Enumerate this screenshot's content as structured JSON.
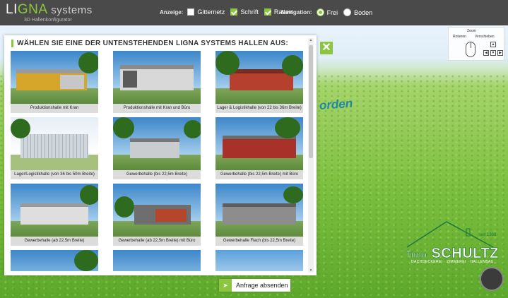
{
  "app": {
    "logo_main_a": "LI",
    "logo_main_b": "GNA",
    "logo_main_c": " systems",
    "logo_sub": "3D Hallenkonfigurator"
  },
  "toolbar": {
    "display_label": "Anzeige:",
    "display_options": [
      {
        "label": "Gitternetz",
        "checked": false
      },
      {
        "label": "Schrift",
        "checked": true
      },
      {
        "label": "Rasen",
        "checked": true
      }
    ],
    "nav_label": "Navigation:",
    "nav_options": [
      {
        "label": "Frei",
        "selected": true
      },
      {
        "label": "Boden",
        "selected": false
      }
    ]
  },
  "panel": {
    "title": "WÄHLEN SIE EINE DER UNTENSTEHENDEN LIGNA SYSTEMS HALLEN AUS:",
    "tiles": [
      "Produktionshalle mit Kran",
      "Produktionshalle mit Kran und Büro",
      "Lager & Logistikhalle (von 22 bis 36m Breite)",
      "Lager/Logistikhalle (von 36 bis 50m Breite)",
      "Gewerbehalle (bis 22,5m Breite)",
      "Gewerbehalle (bis 22,5m Breite) mit Büro",
      "Gewerbehalle (ab 22,5m Breite)",
      "Gewerbehalle (ab 22,5m Breite) mit Büro",
      "Gewerbehalle Flach (bis 22,5m Breite)",
      "",
      "",
      ""
    ]
  },
  "scene": {
    "label": "orden"
  },
  "navhelp": {
    "zoom": "Zoom",
    "rotate": "Rotieren",
    "move": "Verschieben"
  },
  "brand": {
    "name_small": "Timo",
    "name_big": "SCHULTZ",
    "since": "seit 1998",
    "tagline": "DACHDECKEREI · ZIMMEREI · HALLENBAU"
  },
  "submit": {
    "label": "Anfrage absenden"
  },
  "colors": {
    "accent": "#8cc63f",
    "topbar": "#4a4a4a"
  }
}
